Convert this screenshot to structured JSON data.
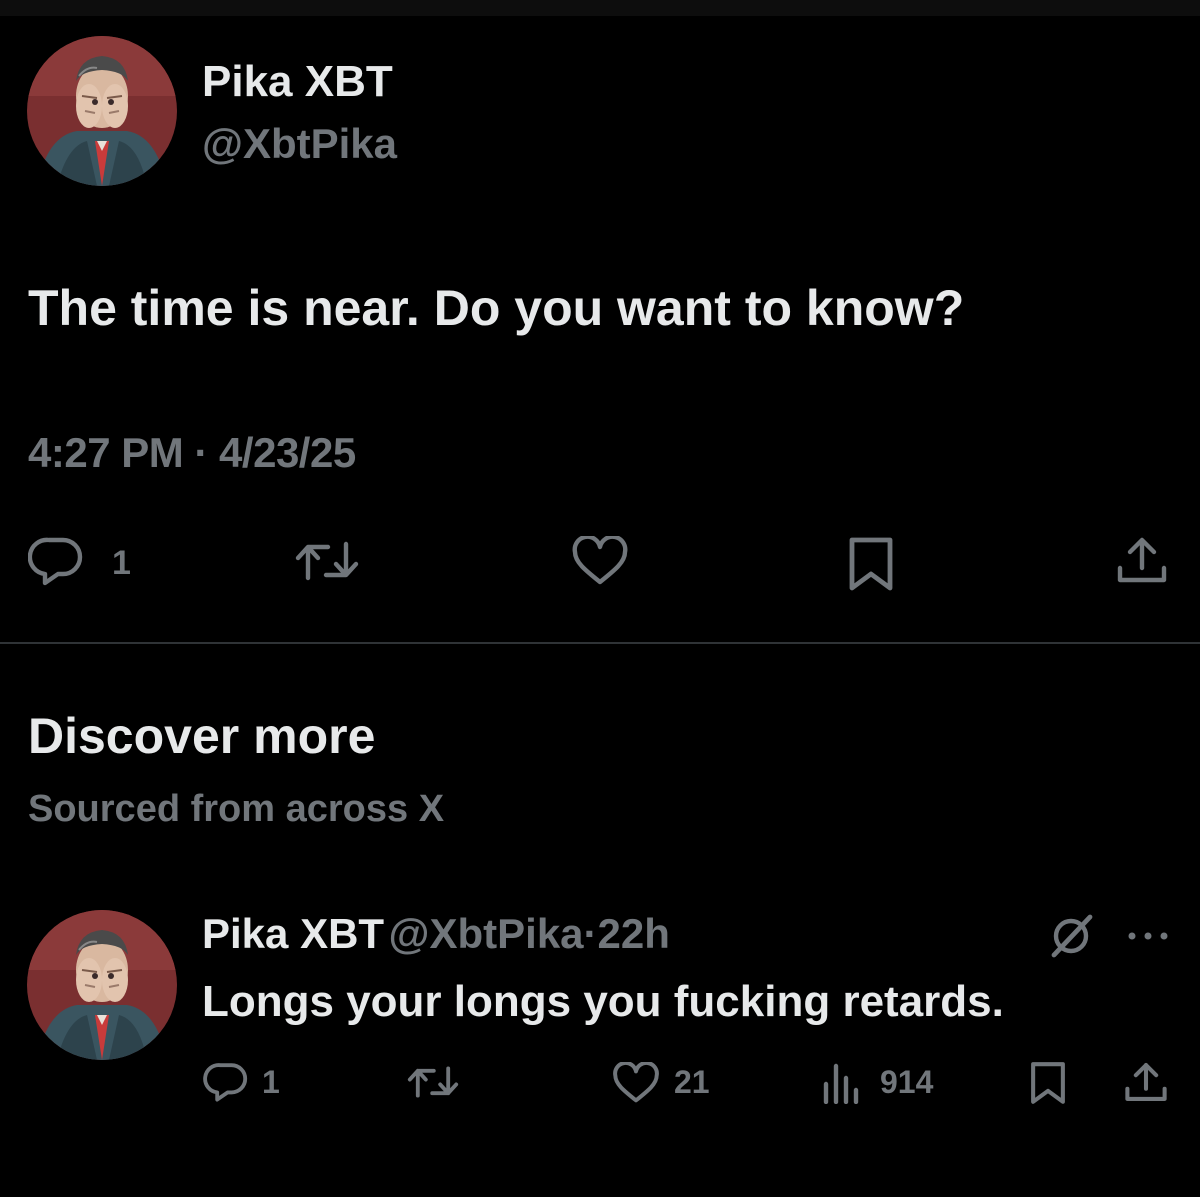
{
  "main_tweet": {
    "author_name": "Pika XBT",
    "author_handle": "@XbtPika",
    "text": "The time is near. Do you want to know?",
    "timestamp": "4:27 PM · 4/23/25",
    "reply_count": "1",
    "icons": [
      "reply-icon",
      "retweet-icon",
      "like-icon",
      "bookmark-icon",
      "share-icon"
    ]
  },
  "discover": {
    "title": "Discover more",
    "subtitle": "Sourced from across X"
  },
  "suggested_tweet": {
    "author_name": "Pika XBT",
    "author_handle": "@XbtPika",
    "separator": "·",
    "age": "22h",
    "text": "Longs your longs you fucking retards.",
    "reply_count": "1",
    "like_count": "21",
    "view_count": "914",
    "icons": [
      "grok-icon",
      "more-icon",
      "reply-icon",
      "retweet-icon",
      "like-icon",
      "views-icon",
      "bookmark-icon",
      "share-icon"
    ]
  },
  "colors": {
    "background": "#000000",
    "primary_text": "#e7e9ea",
    "secondary_text": "#71767b",
    "divider": "#2f3336"
  }
}
